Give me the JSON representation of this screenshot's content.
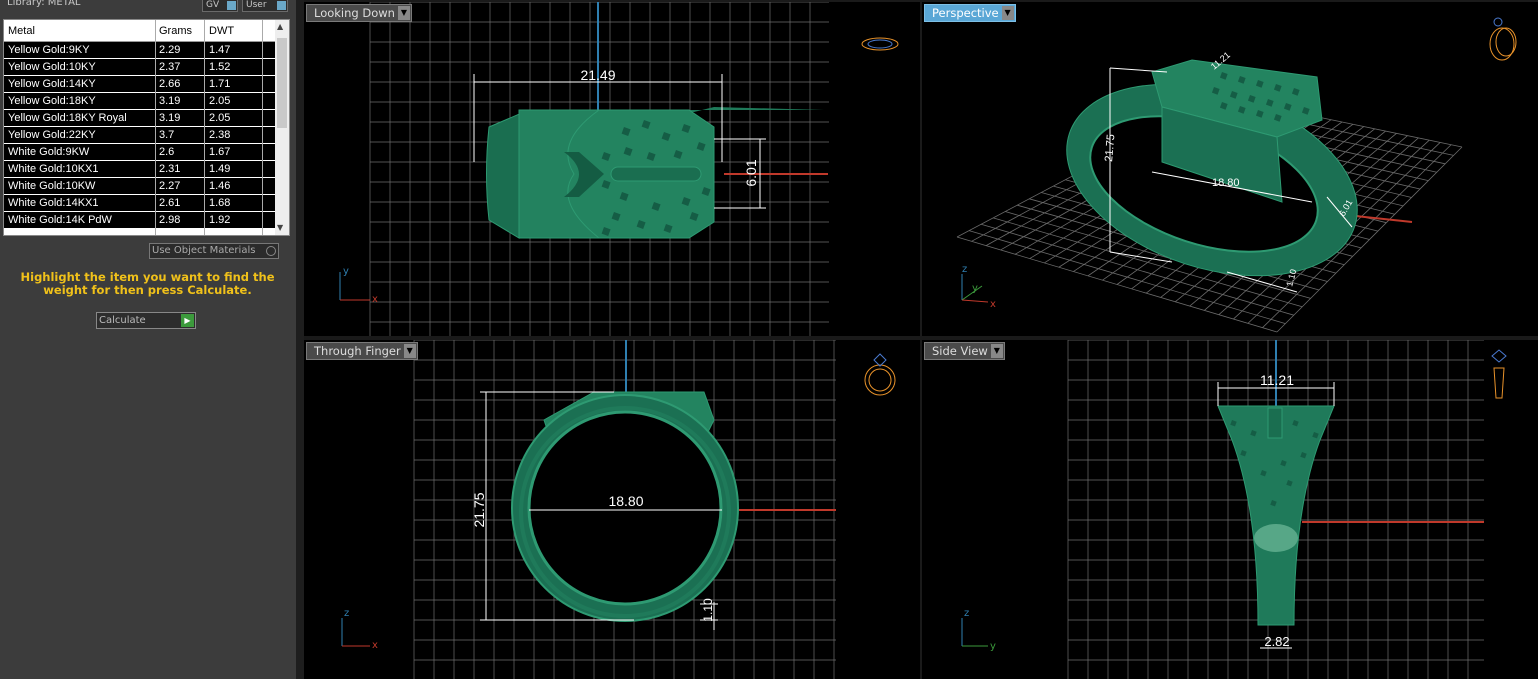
{
  "library": {
    "title": "Library: METAL",
    "gv_label": "GV",
    "user_label": "User"
  },
  "table": {
    "headers": [
      "Metal",
      "Grams",
      "DWT"
    ],
    "rows": [
      [
        "Yellow Gold:9KY",
        "2.29",
        "1.47"
      ],
      [
        "Yellow Gold:10KY",
        "2.37",
        "1.52"
      ],
      [
        "Yellow Gold:14KY",
        "2.66",
        "1.71"
      ],
      [
        "Yellow Gold:18KY",
        "3.19",
        "2.05"
      ],
      [
        "Yellow Gold:18KY Royal",
        "3.19",
        "2.05"
      ],
      [
        "Yellow Gold:22KY",
        "3.7",
        "2.38"
      ],
      [
        "White Gold:9KW",
        "2.6",
        "1.67"
      ],
      [
        "White Gold:10KX1",
        "2.31",
        "1.49"
      ],
      [
        "White Gold:10KW",
        "2.27",
        "1.46"
      ],
      [
        "White Gold:14KX1",
        "2.61",
        "1.68"
      ],
      [
        "White Gold:14K PdW",
        "2.98",
        "1.92"
      ]
    ]
  },
  "use_object_materials_label": "Use Object Materials",
  "hint_text": "Highlight the item you want to find the weight for then press Calculate.",
  "calculate_label": "Calculate",
  "viewports": {
    "top": {
      "label": "Looking Down",
      "dims": [
        "21.49",
        "6.01"
      ],
      "axes": [
        "y",
        "x"
      ]
    },
    "perspective": {
      "label": "Perspective",
      "dims": [
        "21.75",
        "18.80",
        "11.21",
        "6.01",
        "1.10"
      ],
      "axes": [
        "z",
        "y",
        "x"
      ]
    },
    "front": {
      "label": "Through Finger",
      "dims": [
        "21.75",
        "18.80",
        "1.10"
      ],
      "axes": [
        "z",
        "x"
      ]
    },
    "side": {
      "label": "Side View",
      "dims": [
        "11.21",
        "2.82"
      ],
      "axes": [
        "z",
        "y"
      ]
    }
  },
  "colors": {
    "ring": "#1f7a5a",
    "ring_light": "#2e9a72",
    "grid": "#7a7a7a",
    "accent": "#5aa7d6",
    "hint": "#f0c11a",
    "axis_red": "#c0392b",
    "axis_blue": "#2f7fb0"
  }
}
